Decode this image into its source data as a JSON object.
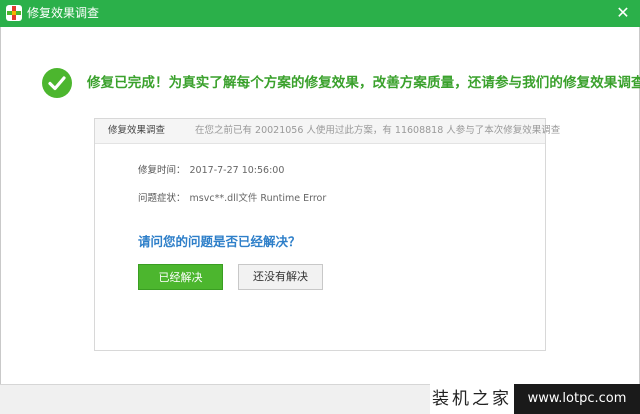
{
  "window": {
    "title": "修复效果调查",
    "close_glyph": "✕",
    "accent_color": "#2bb04a"
  },
  "main": {
    "headline": "修复已完成！为真实了解每个方案的修复效果，改善方案质量，还请参与我们的修复效果调查！",
    "check_icon": "check-circle-icon"
  },
  "card": {
    "title": "修复效果调查",
    "note": "在您之前已有 20021056 人使用过此方案，有 11608818 人参与了本次修复效果调查",
    "fields": [
      {
        "label": "修复时间：",
        "value": "2017-7-27 10:56:00"
      },
      {
        "label": "问题症状：",
        "value": "msvc**.dll文件 Runtime Error"
      }
    ],
    "question": "请问您的问题是否已经解决？",
    "buttons": {
      "yes": "已经解决",
      "no": "还没有解决"
    }
  },
  "watermark": {
    "label": "装机之家",
    "url": "www.lotpc.com"
  }
}
